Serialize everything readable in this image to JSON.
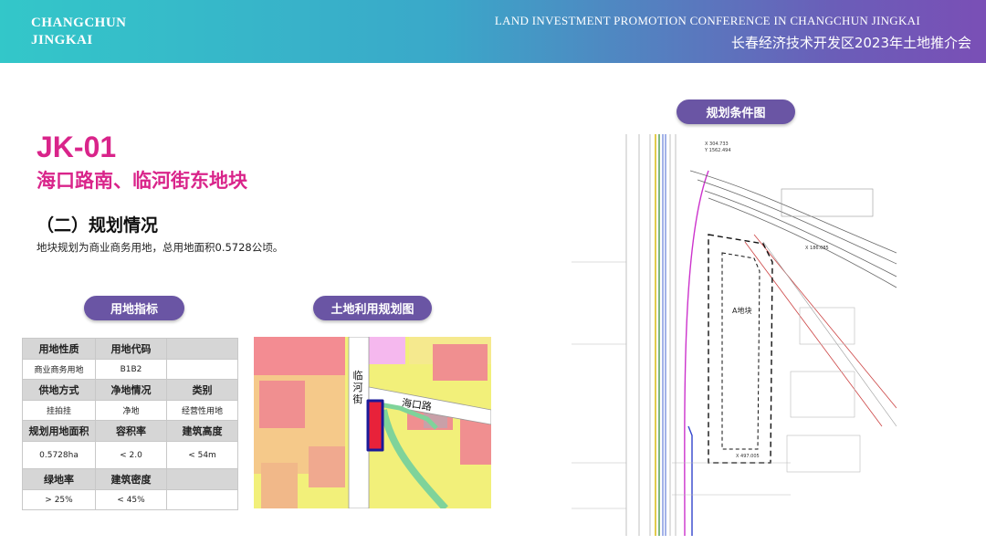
{
  "header": {
    "logo_line1": "CHANGCHUN",
    "logo_line2": "JINGKAI",
    "conference_en": "LAND INVESTMENT PROMOTION CONFERENCE IN CHANGCHUN JINGKAI",
    "conference_cn": "长春经济技术开发区2023年土地推介会"
  },
  "parcel": {
    "code": "JK-01",
    "name": "海口路南、临河街东地块"
  },
  "section": {
    "title": "（二）规划情况",
    "description": "地块规划为商业商务用地，总用地面积0.5728公顷。"
  },
  "pills": {
    "indicators": "用地指标",
    "land_use_map": "土地利用规划图",
    "planning_map": "规划条件图"
  },
  "table": {
    "rows": [
      {
        "type": "h",
        "cells": [
          "用地性质",
          "用地代码",
          ""
        ]
      },
      {
        "type": "v",
        "cells": [
          "商业商务用地",
          "B1B2",
          ""
        ]
      },
      {
        "type": "h",
        "cells": [
          "供地方式",
          "净地情况",
          "类别"
        ]
      },
      {
        "type": "v",
        "cells": [
          "挂拍挂",
          "净地",
          "经营性用地"
        ]
      },
      {
        "type": "h",
        "cells": [
          "规划用地面积",
          "容积率",
          "建筑高度"
        ]
      },
      {
        "type": "tall",
        "cells": [
          "0.5728ha",
          "< 2.0",
          "< 54m"
        ]
      },
      {
        "type": "h",
        "cells": [
          "绿地率",
          "建筑密度",
          ""
        ]
      },
      {
        "type": "v",
        "cells": [
          "> 25%",
          "< 45%",
          ""
        ]
      }
    ]
  },
  "land_use_map": {
    "street_vertical": "临河街",
    "street_horizontal": "海口路"
  },
  "planning_map": {
    "parcel_label": "A地块",
    "coord_1": "X 304.733",
    "coord_2": "Y 1562.494",
    "coord_3": "X 186.085",
    "coord_4": "X 497.005"
  },
  "colors": {
    "accent": "#d9248a",
    "pill": "#6a55a4",
    "header_start": "#33c7c9",
    "header_end": "#7a4fb6"
  }
}
